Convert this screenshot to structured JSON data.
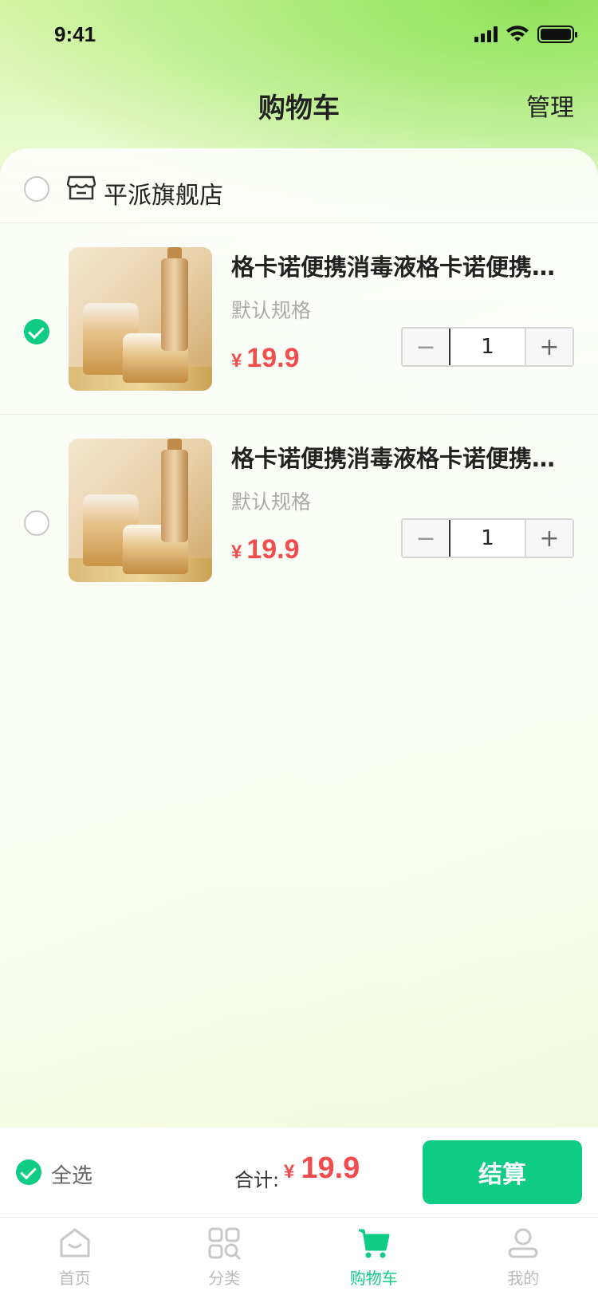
{
  "status_bar": {
    "time": "9:41"
  },
  "nav": {
    "title": "购物车",
    "manage": "管理"
  },
  "shop": {
    "name": "平派旗舰店",
    "checked": false
  },
  "items": [
    {
      "title": "格卡诺便携消毒液格卡诺便携消毒液",
      "spec": "默认规格",
      "currency": "¥",
      "price": "19.9",
      "quantity": "1",
      "checked": true
    },
    {
      "title": "格卡诺便携消毒液格卡诺便携消毒液",
      "spec": "默认规格",
      "currency": "¥",
      "price": "19.9",
      "quantity": "1",
      "checked": false
    }
  ],
  "stepper": {
    "minus": "−",
    "plus": "+"
  },
  "checkout": {
    "select_all": "全选",
    "total_label": "合计:",
    "currency": "¥",
    "total": "19.9",
    "button": "结算"
  },
  "tabbar": [
    {
      "label": "首页",
      "icon": "home-icon",
      "active": false
    },
    {
      "label": "分类",
      "icon": "category-icon",
      "active": false
    },
    {
      "label": "购物车",
      "icon": "cart-icon",
      "active": true
    },
    {
      "label": "我的",
      "icon": "user-icon",
      "active": false
    }
  ],
  "colors": {
    "accent": "#0fcc85",
    "price": "#f24d4d"
  }
}
